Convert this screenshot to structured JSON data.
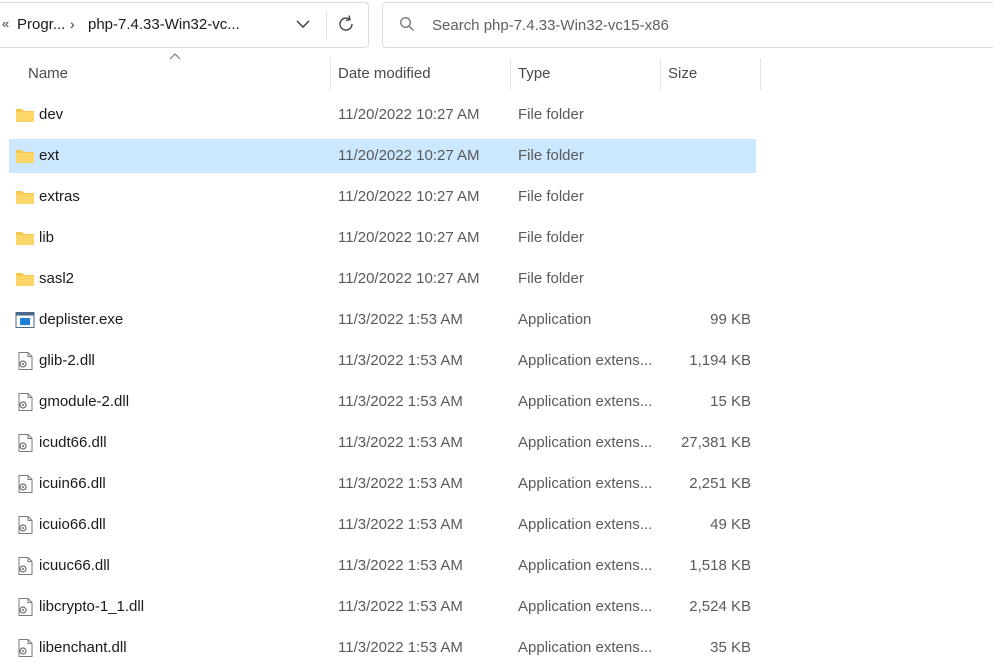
{
  "address_bar": {
    "overflow_glyph": "«",
    "crumbs": [
      "Progr...",
      "php-7.4.33-Win32-vc..."
    ],
    "separator": "›",
    "dropdown_icon": "chevron-down-icon",
    "refresh_icon": "refresh-icon"
  },
  "search": {
    "placeholder": "Search php-7.4.33-Win32-vc15-x86",
    "icon": "search-icon"
  },
  "columns": {
    "name": "Name",
    "date": "Date modified",
    "type": "Type",
    "size": "Size",
    "sort_icon": "sort-up-caret-icon"
  },
  "colors": {
    "selection": "#cce8ff",
    "folder": "#f0c14b"
  },
  "files": [
    {
      "name": "dev",
      "date": "11/20/2022 10:27 AM",
      "type": "File folder",
      "size": "",
      "icon": "folder-icon"
    },
    {
      "name": "ext",
      "date": "11/20/2022 10:27 AM",
      "type": "File folder",
      "size": "",
      "icon": "folder-icon",
      "selected": true
    },
    {
      "name": "extras",
      "date": "11/20/2022 10:27 AM",
      "type": "File folder",
      "size": "",
      "icon": "folder-icon"
    },
    {
      "name": "lib",
      "date": "11/20/2022 10:27 AM",
      "type": "File folder",
      "size": "",
      "icon": "folder-icon"
    },
    {
      "name": "sasl2",
      "date": "11/20/2022 10:27 AM",
      "type": "File folder",
      "size": "",
      "icon": "folder-icon"
    },
    {
      "name": "deplister.exe",
      "date": "11/3/2022 1:53 AM",
      "type": "Application",
      "size": "99 KB",
      "icon": "application-icon"
    },
    {
      "name": "glib-2.dll",
      "date": "11/3/2022 1:53 AM",
      "type": "Application extens...",
      "size": "1,194 KB",
      "icon": "dll-file-icon"
    },
    {
      "name": "gmodule-2.dll",
      "date": "11/3/2022 1:53 AM",
      "type": "Application extens...",
      "size": "15 KB",
      "icon": "dll-file-icon"
    },
    {
      "name": "icudt66.dll",
      "date": "11/3/2022 1:53 AM",
      "type": "Application extens...",
      "size": "27,381 KB",
      "icon": "dll-file-icon"
    },
    {
      "name": "icuin66.dll",
      "date": "11/3/2022 1:53 AM",
      "type": "Application extens...",
      "size": "2,251 KB",
      "icon": "dll-file-icon"
    },
    {
      "name": "icuio66.dll",
      "date": "11/3/2022 1:53 AM",
      "type": "Application extens...",
      "size": "49 KB",
      "icon": "dll-file-icon"
    },
    {
      "name": "icuuc66.dll",
      "date": "11/3/2022 1:53 AM",
      "type": "Application extens...",
      "size": "1,518 KB",
      "icon": "dll-file-icon"
    },
    {
      "name": "libcrypto-1_1.dll",
      "date": "11/3/2022 1:53 AM",
      "type": "Application extens...",
      "size": "2,524 KB",
      "icon": "dll-file-icon"
    },
    {
      "name": "libenchant.dll",
      "date": "11/3/2022 1:53 AM",
      "type": "Application extens...",
      "size": "35 KB",
      "icon": "dll-file-icon"
    }
  ]
}
